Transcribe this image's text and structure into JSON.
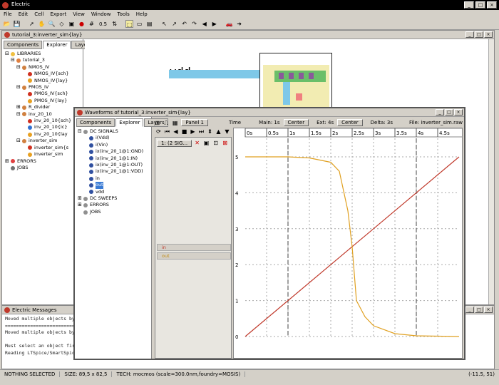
{
  "app": {
    "title": "Electric"
  },
  "menu": [
    "File",
    "Edit",
    "Cell",
    "Export",
    "View",
    "Window",
    "Tools",
    "Help"
  ],
  "toolbar": {
    "zoom_value": "0.5"
  },
  "edit_window": {
    "title": "tutorial_3:inverter_sim{lay}",
    "tabs": [
      "Components",
      "Explorer",
      "Layers"
    ],
    "active_tab": "Explorer",
    "tree": [
      {
        "label": "LIBRARIES",
        "level": 0,
        "expander": "-",
        "icon": "folder"
      },
      {
        "label": "tutorial_3",
        "level": 1,
        "expander": "-",
        "icon": "library"
      },
      {
        "label": "NMOS_IV",
        "level": 2,
        "expander": "-",
        "icon": "cell"
      },
      {
        "label": "NMOS_IV{sch}",
        "level": 3,
        "expander": "",
        "icon": "red"
      },
      {
        "label": "NMOS_IV{lay}",
        "level": 3,
        "expander": "",
        "icon": "orange"
      },
      {
        "label": "PMOS_IV",
        "level": 2,
        "expander": "-",
        "icon": "cell"
      },
      {
        "label": "PMOS_IV{sch}",
        "level": 3,
        "expander": "",
        "icon": "red"
      },
      {
        "label": "PMOS_IV{lay}",
        "level": 3,
        "expander": "",
        "icon": "orange"
      },
      {
        "label": "R_divider",
        "level": 2,
        "expander": "+",
        "icon": "cell"
      },
      {
        "label": "inv_20_10",
        "level": 2,
        "expander": "-",
        "icon": "cell"
      },
      {
        "label": "inv_20_10{sch}",
        "level": 3,
        "expander": "",
        "icon": "red"
      },
      {
        "label": "inv_20_10{ic}",
        "level": 3,
        "expander": "",
        "icon": "blue"
      },
      {
        "label": "inv_20_10{lay",
        "level": 3,
        "expander": "",
        "icon": "orange"
      },
      {
        "label": "inverter_sim",
        "level": 2,
        "expander": "-",
        "icon": "cell"
      },
      {
        "label": "inverter_sim{s",
        "level": 3,
        "expander": "",
        "icon": "red"
      },
      {
        "label": "inverter_sim",
        "level": 3,
        "expander": "",
        "icon": "orange"
      },
      {
        "label": "ERRORS",
        "level": 0,
        "expander": "+",
        "icon": "error"
      },
      {
        "label": "JOBS",
        "level": 0,
        "expander": "",
        "icon": "jobs"
      }
    ],
    "layout_label": "vdd"
  },
  "wave_window": {
    "title": "Waveforms of tutorial_3:inverter_sim{lay}",
    "tabs": [
      "Components",
      "Explorer",
      "Layers"
    ],
    "active_tab": "Explorer",
    "panel_select": "Panel 1",
    "time_label": "Time",
    "main_label": "Main: 1s",
    "center1": "Center",
    "ext_label": "Ext: 4s",
    "center2": "Center",
    "delta_label": "Delta: 3s",
    "file_label": "File: inverter_sim.raw",
    "signal_button": "1: (2 SIG...",
    "tree": [
      {
        "label": "DC SIGNALS",
        "level": 0,
        "expander": "-"
      },
      {
        "label": "i(Vdd)",
        "level": 1
      },
      {
        "label": "i(Vin)",
        "level": 1
      },
      {
        "label": "ix(inv_20_1@1:GND)",
        "level": 1
      },
      {
        "label": "ix(inv_20_1@1:IN)",
        "level": 1
      },
      {
        "label": "ix(inv_20_1@1:OUT)",
        "level": 1
      },
      {
        "label": "ix(inv_20_1@1:VDD)",
        "level": 1
      },
      {
        "label": "in",
        "level": 1
      },
      {
        "label": "out",
        "level": 1,
        "selected": true
      },
      {
        "label": "vdd",
        "level": 1
      },
      {
        "label": "DC SWEEPS",
        "level": 0,
        "expander": "+"
      },
      {
        "label": "ERRORS",
        "level": 0,
        "expander": "+"
      },
      {
        "label": "JOBS",
        "level": 0,
        "expander": ""
      }
    ],
    "signal_tags": [
      "in",
      "out"
    ],
    "time_ticks": [
      "0s",
      "0.5s",
      "1s",
      "1.5s",
      "2s",
      "2.5s",
      "3s",
      "3.5s",
      "4s",
      "4.5s"
    ],
    "colors": {
      "in": "#c0392b",
      "out": "#e0a020"
    }
  },
  "chart_data": {
    "type": "line",
    "x_ticks": [
      "0s",
      "0.5s",
      "1s",
      "1.5s",
      "2s",
      "2.5s",
      "3s",
      "3.5s",
      "4s",
      "4.5s"
    ],
    "y_ticks": [
      "0",
      "1",
      "2",
      "3",
      "4",
      "5"
    ],
    "xlim": [
      0,
      5
    ],
    "ylim": [
      0,
      5
    ],
    "cursors": [
      1,
      4
    ],
    "series": [
      {
        "name": "in",
        "x": [
          0,
          5
        ],
        "y": [
          0,
          5
        ]
      },
      {
        "name": "out",
        "x": [
          0,
          1,
          1.5,
          2,
          2.2,
          2.4,
          2.5,
          2.6,
          2.8,
          3,
          3.5,
          4,
          5
        ],
        "y": [
          5,
          5,
          4.97,
          4.85,
          4.6,
          3.5,
          2.5,
          1.0,
          0.55,
          0.3,
          0.08,
          0.02,
          0
        ]
      }
    ]
  },
  "messages": {
    "title": "Electric Messages",
    "lines": [
      "Moved multiple objects by (1",
      "=============================",
      "Moved multiple objects by (0",
      "",
      "Must select an object first",
      "Reading LTSpice/SmartSpice r"
    ]
  },
  "status": {
    "selection": "NOTHING SELECTED",
    "size": "SIZE: 89,5 x 82,5",
    "tech": "TECH: mocmos (scale=300.0nm,foundry=MOSIS)",
    "coords": "(-11.5, 51)"
  }
}
